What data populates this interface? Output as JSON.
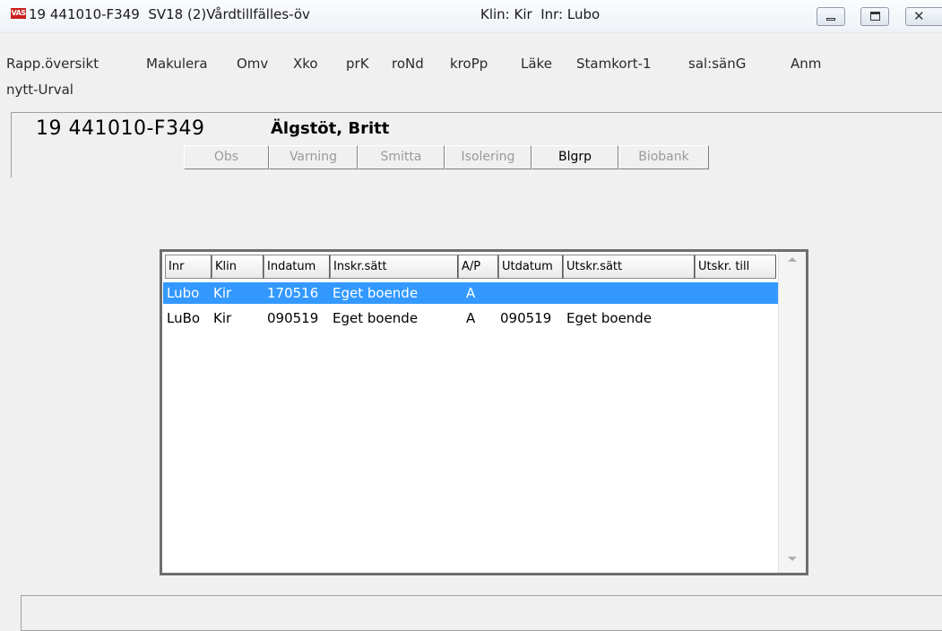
{
  "window": {
    "icon_text": "VAS",
    "title": "19 441010-F349  SV18 (2)Vårdtillfälles-öv",
    "context": "Klin: Kir  Inr: Lubo"
  },
  "menu": {
    "row1": [
      "Rapp.översikt",
      "Makulera",
      "Omv",
      "Xko",
      "prK",
      "roNd",
      "kroPp",
      "Läke",
      "Stamkort-1",
      "sal:sänG",
      "Anm"
    ],
    "row2": [
      "nytt-Urval"
    ]
  },
  "patient": {
    "id": "19 441010-F349",
    "name": "Älgstöt, Britt"
  },
  "tabs": [
    {
      "label": "Obs",
      "enabled": false
    },
    {
      "label": "Varning",
      "enabled": false
    },
    {
      "label": "Smitta",
      "enabled": false
    },
    {
      "label": "Isolering",
      "enabled": false
    },
    {
      "label": "Blgrp",
      "enabled": true
    },
    {
      "label": "Biobank",
      "enabled": false
    }
  ],
  "table": {
    "columns": [
      "Inr",
      "Klin",
      "Indatum",
      "Inskr.sätt",
      "A/P",
      "Utdatum",
      "Utskr.sätt",
      "Utskr. till"
    ],
    "rows": [
      {
        "selected": true,
        "cells": [
          "Lubo",
          "Kir",
          "170516",
          "Eget boende",
          "A",
          "",
          "",
          ""
        ]
      },
      {
        "selected": false,
        "cells": [
          "LuBo",
          "Kir",
          "090519",
          "Eget boende",
          "A",
          "090519",
          "Eget boende",
          ""
        ]
      }
    ]
  },
  "colors": {
    "selection": "#3399ff",
    "selection_text": "#ffffff",
    "icon_red": "#c8201e"
  }
}
